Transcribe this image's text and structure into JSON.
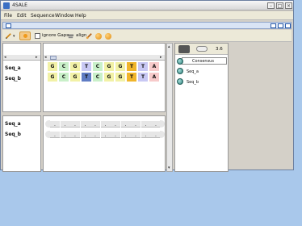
{
  "app": {
    "title": "4SALE"
  },
  "menu": [
    "File",
    "Edit",
    "Sequence",
    "Window",
    "Help"
  ],
  "toolbar": {
    "ignore_gaps_label": "ignore Gaps",
    "align_label": "align"
  },
  "names": [
    "Seq_a",
    "Seq_b"
  ],
  "sequences": {
    "residues": [
      [
        "G",
        "C",
        "G",
        "T",
        "C",
        "G",
        "G",
        "T",
        "T",
        "A"
      ],
      [
        "G",
        "C",
        "G",
        "T",
        "C",
        "G",
        "G",
        "T",
        "T",
        "A"
      ]
    ]
  },
  "colors": {
    "G": "#f2f1a6",
    "C": "#c9f0c9",
    "T": "#c8c8f4",
    "A": "#f7caca",
    "highlight": "#f0b52b",
    "selection": "#5f7cc4"
  },
  "structure": {
    "names": [
      "Seq_a",
      "Seq_b"
    ],
    "dot": "."
  },
  "right_panel": {
    "zoom": "3.6",
    "consensus": "Consensus",
    "items": [
      "Seq_a",
      "Seq_b"
    ]
  },
  "icons": [
    "pencil-icon",
    "dropdown-icon",
    "highlight-icon",
    "checkbox-icon",
    "align-icon",
    "brush-icon",
    "circle-orange-icon",
    "circle-orange-icon",
    "shield-icon",
    "slider-icon"
  ]
}
